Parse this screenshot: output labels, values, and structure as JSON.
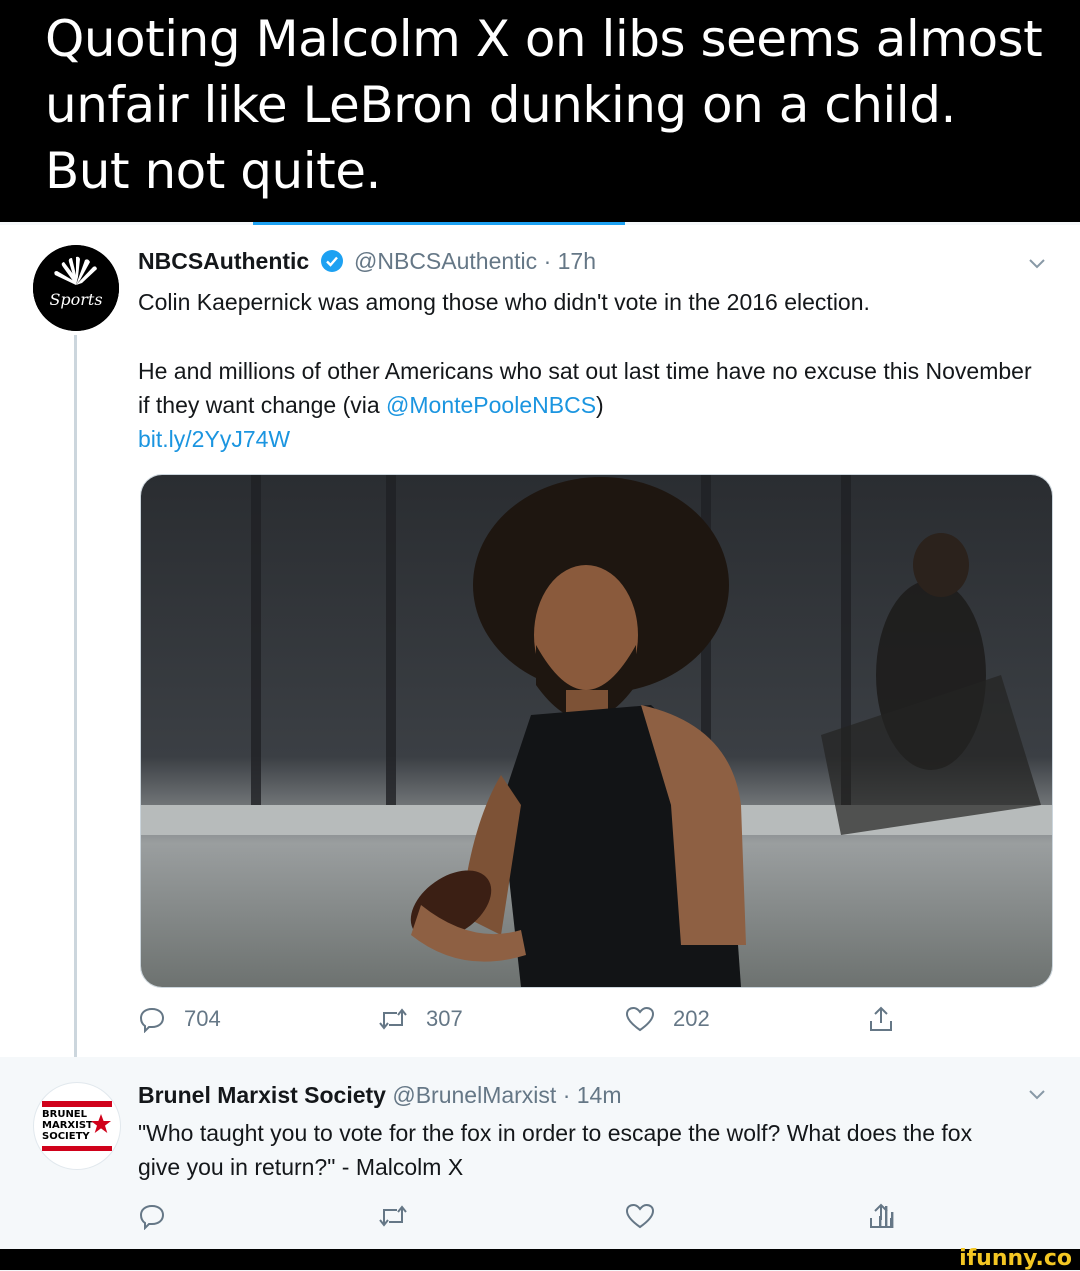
{
  "meme": {
    "caption": "Quoting Malcolm X on libs seems almost unfair like LeBron dunking on a child. But not quite.",
    "watermark": "ifunny.co"
  },
  "tweet1": {
    "name": "NBCSAuthentic",
    "handle": "@NBCSAuthentic",
    "time": "· 17h",
    "line1": "Colin Kaepernick was among those who didn't vote in the 2016 election.",
    "line2_pre": "He and millions of other Americans who sat out last time have no excuse this November if they want change (via ",
    "mention": "@MontePooleNBCS",
    "line2_post": ")",
    "link": "bit.ly/2YyJ74W",
    "avatar_text": "Sports",
    "replies": "704",
    "retweets": "307",
    "likes": "202"
  },
  "tweet2": {
    "name": "Brunel Marxist Society",
    "handle": "@BrunelMarxist",
    "time": "· 14m",
    "text": "\"Who taught you to vote for the fox in order to escape the wolf? What does the fox give you in return?\" - Malcolm X",
    "avatar_text": "BRUNEL MARXIST SOCIETY"
  },
  "colors": {
    "link": "#1b95e0",
    "verified": "#1da1f2",
    "meta": "#657786"
  },
  "icons": [
    "verified-badge-icon",
    "chevron-down-icon",
    "reply-icon",
    "retweet-icon",
    "like-icon",
    "share-icon",
    "analytics-icon"
  ]
}
